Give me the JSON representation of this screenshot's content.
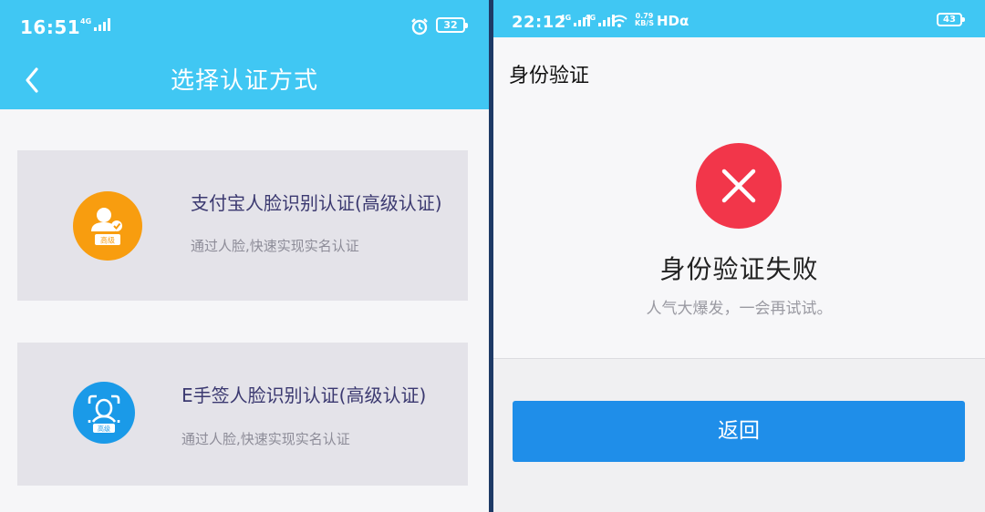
{
  "left_screen": {
    "status_bar": {
      "time": "16:51",
      "network": "4G",
      "battery": "32",
      "icons": [
        "signal-icon",
        "alarm-icon",
        "battery-icon"
      ]
    },
    "header": {
      "title": "选择认证方式",
      "back_icon": "chevron-left-icon"
    },
    "options": [
      {
        "title": "支付宝人脸识别认证(高级认证)",
        "subtitle": "通过人脸,快速实现实名认证",
        "icon": "face-id-badge-icon",
        "icon_badge": "高级",
        "icon_color": "#f89d0f"
      },
      {
        "title": "E手签人脸识别认证(高级认证)",
        "subtitle": "通过人脸,快速实现实名认证",
        "icon": "face-scan-icon",
        "icon_badge": "高级",
        "icon_color": "#1a9ae8"
      }
    ]
  },
  "right_screen": {
    "status_bar": {
      "time": "22:12",
      "network_1": "4G",
      "network_2": "4G",
      "rate_value": "0.79",
      "rate_unit": "KB/S",
      "hd_label": "HDα",
      "battery": "43",
      "icons": [
        "signal-icon",
        "wifi-icon",
        "battery-icon"
      ]
    },
    "page_title": "身份验证",
    "result": {
      "icon": "error-x-icon",
      "title": "身份验证失败",
      "message": "人气大爆发，一会再试试。"
    },
    "return_button": "返回"
  },
  "colors": {
    "header_blue": "#40c7f3",
    "error_red": "#f2364a",
    "button_blue": "#1f8ee9",
    "card_bg": "#e4e3e9",
    "card_title": "#3b3970"
  }
}
